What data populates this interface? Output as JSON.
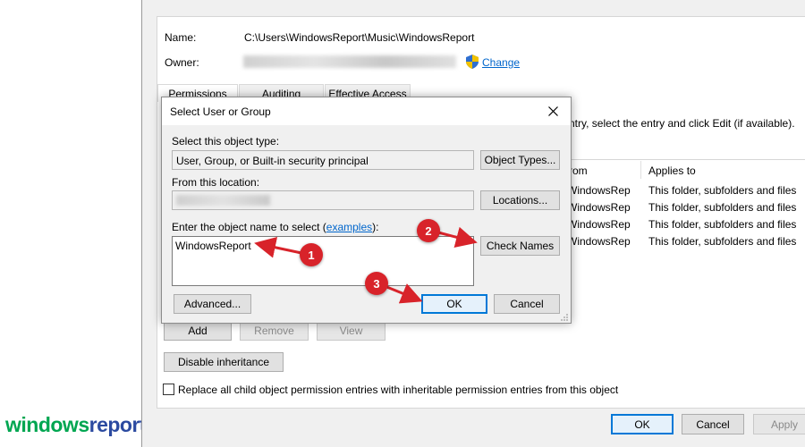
{
  "watermark": {
    "brand_part1": "windows",
    "brand_part2": "report"
  },
  "outer": {
    "name_label": "Name:",
    "name_value": "C:\\Users\\WindowsReport\\Music\\WindowsReport",
    "owner_label": "Owner:",
    "owner_value_obscured": "",
    "change_link": "Change",
    "tabs": [
      {
        "label": "Permissions",
        "active": true
      },
      {
        "label": "Auditing",
        "active": false
      },
      {
        "label": "Effective Access",
        "active": false
      }
    ],
    "instruction_partial": "ntry, select the entry and click Edit (if available).",
    "columns": {
      "from": "rom",
      "applies_to": "Applies to"
    },
    "rows": [
      {
        "from": "WindowsRep",
        "applies_to": "This folder, subfolders and files"
      },
      {
        "from": "WindowsRep",
        "applies_to": "This folder, subfolders and files"
      },
      {
        "from": "WindowsRep",
        "applies_to": "This folder, subfolders and files"
      },
      {
        "from": "WindowsRep",
        "applies_to": "This folder, subfolders and files"
      }
    ],
    "add_button": "Add",
    "remove_button": "Remove",
    "view_button": "View",
    "disable_inheritance_button": "Disable inheritance",
    "replace_checkbox_label": "Replace all child object permission entries with inheritable permission entries from this object",
    "replace_checked": false,
    "ok_button": "OK",
    "cancel_button": "Cancel",
    "apply_button": "Apply"
  },
  "dialog": {
    "title": "Select User or Group",
    "object_type_label": "Select this object type:",
    "object_type_value": "User, Group, or Built-in security principal",
    "object_types_button": "Object Types...",
    "location_label": "From this location:",
    "location_value_obscured": "",
    "locations_button": "Locations...",
    "enter_name_label_pre": "Enter the object name to select (",
    "examples_link": "examples",
    "enter_name_label_post": "):",
    "object_name_value": "WindowsReport",
    "check_names_button": "Check Names",
    "advanced_button": "Advanced...",
    "ok_button": "OK",
    "cancel_button": "Cancel"
  },
  "markers": [
    "1",
    "2",
    "3"
  ],
  "colors": {
    "marker": "#d8232a",
    "link": "#0066cc",
    "focus": "#0078d7",
    "brand_green": "#00a651"
  }
}
